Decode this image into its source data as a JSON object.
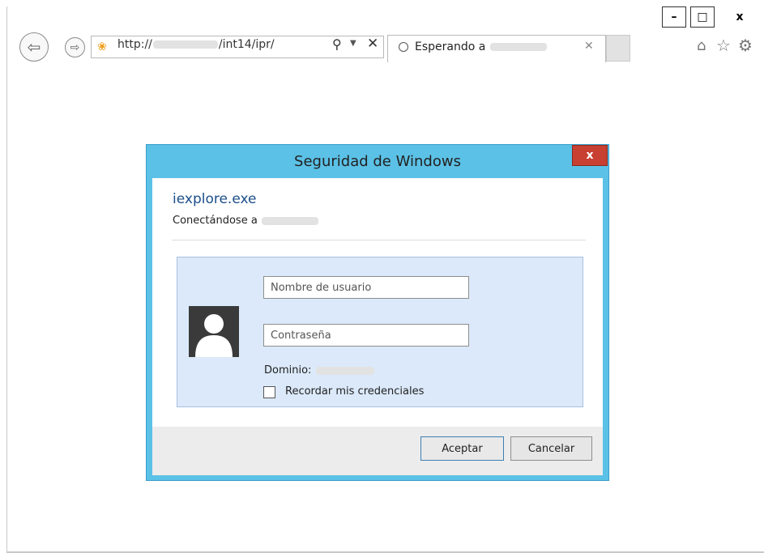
{
  "browser": {
    "address": {
      "prefix": "http://",
      "path": "/int14/ipr/"
    },
    "tab": {
      "title": "Esperando a"
    },
    "window_controls": {
      "minimize": "–",
      "maximize": "□",
      "close": "x"
    }
  },
  "dialog": {
    "title": "Seguridad de Windows",
    "app_name": "iexplore.exe",
    "connecting_label": "Conectándose a",
    "username_placeholder": "Nombre de usuario",
    "password_placeholder": "Contraseña",
    "domain_label": "Dominio:",
    "remember_label": "Recordar mis credenciales",
    "ok_label": "Aceptar",
    "cancel_label": "Cancelar",
    "close_label": "x"
  }
}
